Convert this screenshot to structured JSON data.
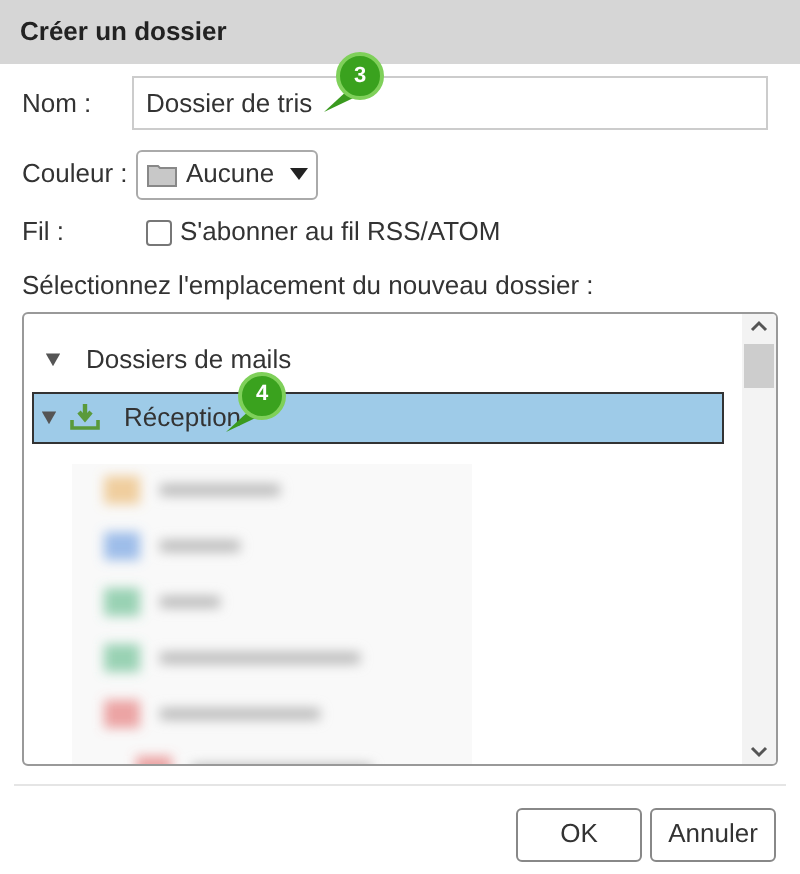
{
  "window": {
    "title": "Créer un dossier"
  },
  "name_field": {
    "label": "Nom :",
    "value": "Dossier de tris"
  },
  "color_field": {
    "label": "Couleur :",
    "value": "Aucune"
  },
  "feed_field": {
    "label": "Fil :",
    "checkbox_label": "S'abonner au fil RSS/ATOM",
    "checked": false
  },
  "location_label": "Sélectionnez l'emplacement du nouveau dossier :",
  "tree": [
    {
      "label": "Dossiers de mails",
      "expanded": true,
      "selected": false,
      "children": [
        {
          "label": "Réception",
          "expanded": true,
          "selected": true
        }
      ]
    }
  ],
  "callouts": [
    "3",
    "4"
  ],
  "buttons": [
    "OK",
    "Annuler"
  ]
}
